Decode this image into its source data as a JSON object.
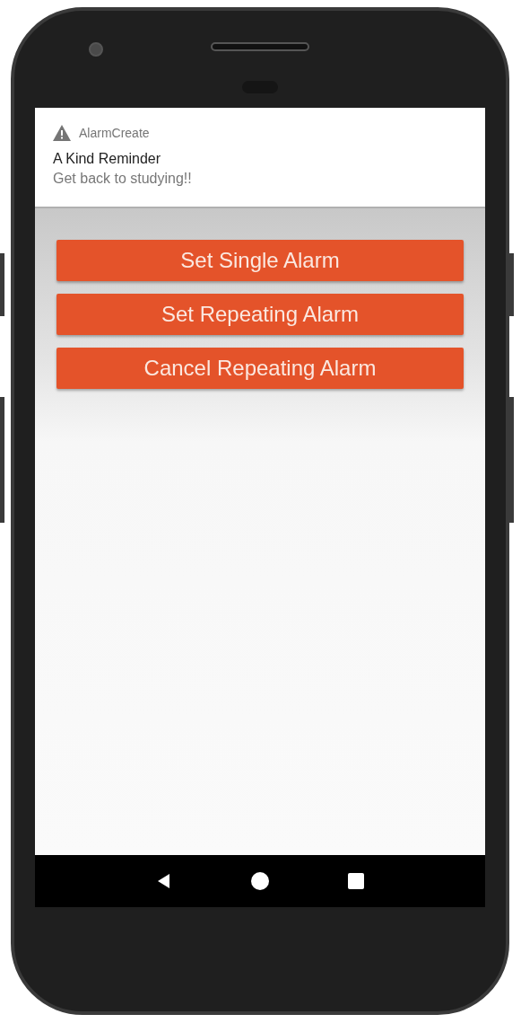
{
  "notification": {
    "app_name": "AlarmCreate",
    "title": "A Kind Reminder",
    "text": "Get back to studying!!"
  },
  "buttons": [
    "Set Single Alarm",
    "Set Repeating Alarm",
    "Cancel Repeating Alarm"
  ]
}
